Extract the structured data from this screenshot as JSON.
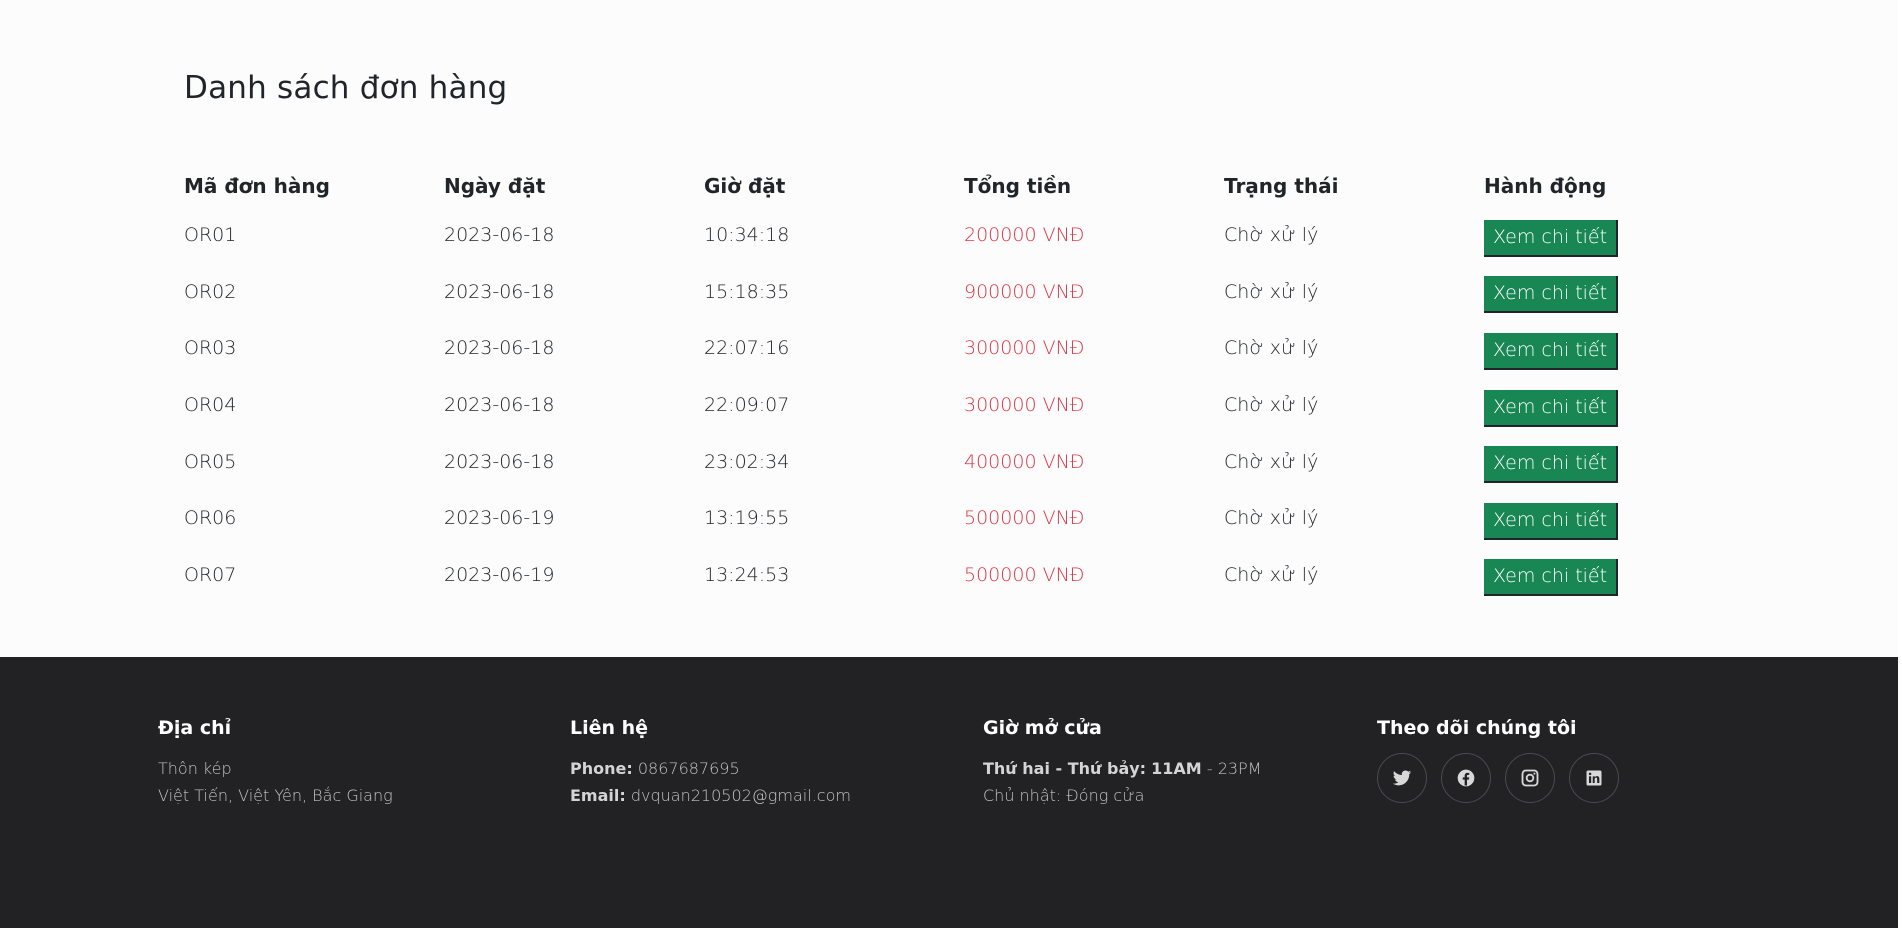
{
  "page_title": "Danh sách đơn hàng",
  "table": {
    "headers": [
      "Mã đơn hàng",
      "Ngày đặt",
      "Giờ đặt",
      "Tổng tiền",
      "Trạng thái",
      "Hành động"
    ],
    "rows": [
      {
        "id": "OR01",
        "date": "2023-06-18",
        "time": "10:34:18",
        "total": "200000 VNĐ",
        "status": "Chờ xử lý",
        "action": "Xem chi tiết"
      },
      {
        "id": "OR02",
        "date": "2023-06-18",
        "time": "15:18:35",
        "total": "900000 VNĐ",
        "status": "Chờ xử lý",
        "action": "Xem chi tiết"
      },
      {
        "id": "OR03",
        "date": "2023-06-18",
        "time": "22:07:16",
        "total": "300000 VNĐ",
        "status": "Chờ xử lý",
        "action": "Xem chi tiết"
      },
      {
        "id": "OR04",
        "date": "2023-06-18",
        "time": "22:09:07",
        "total": "300000 VNĐ",
        "status": "Chờ xử lý",
        "action": "Xem chi tiết"
      },
      {
        "id": "OR05",
        "date": "2023-06-18",
        "time": "23:02:34",
        "total": "400000 VNĐ",
        "status": "Chờ xử lý",
        "action": "Xem chi tiết"
      },
      {
        "id": "OR06",
        "date": "2023-06-19",
        "time": "13:19:55",
        "total": "500000 VNĐ",
        "status": "Chờ xử lý",
        "action": "Xem chi tiết"
      },
      {
        "id": "OR07",
        "date": "2023-06-19",
        "time": "13:24:53",
        "total": "500000 VNĐ",
        "status": "Chờ xử lý",
        "action": "Xem chi tiết"
      }
    ]
  },
  "footer": {
    "address": {
      "title": "Địa chỉ",
      "line1": "Thôn kép",
      "line2": "Việt Tiến, Việt Yên, Bắc Giang"
    },
    "contact": {
      "title": "Liên hệ",
      "phone_label": "Phone:",
      "phone": "0867687695",
      "email_label": "Email:",
      "email": "dvquan210502@gmail.com"
    },
    "hours": {
      "title": "Giờ mở cửa",
      "weekdays_label": "Thứ hai - Thứ bảy:",
      "weekdays_open": "11AM",
      "weekdays_close": "- 23PM",
      "sunday": "Chủ nhật: Đóng cửa"
    },
    "social": {
      "title": "Theo dõi chúng tôi",
      "icons": [
        "twitter-icon",
        "facebook-icon",
        "instagram-icon",
        "linkedin-icon"
      ]
    }
  },
  "colors": {
    "accent_green": "#198754",
    "price_red": "#dc3545",
    "footer_bg": "#222225"
  }
}
